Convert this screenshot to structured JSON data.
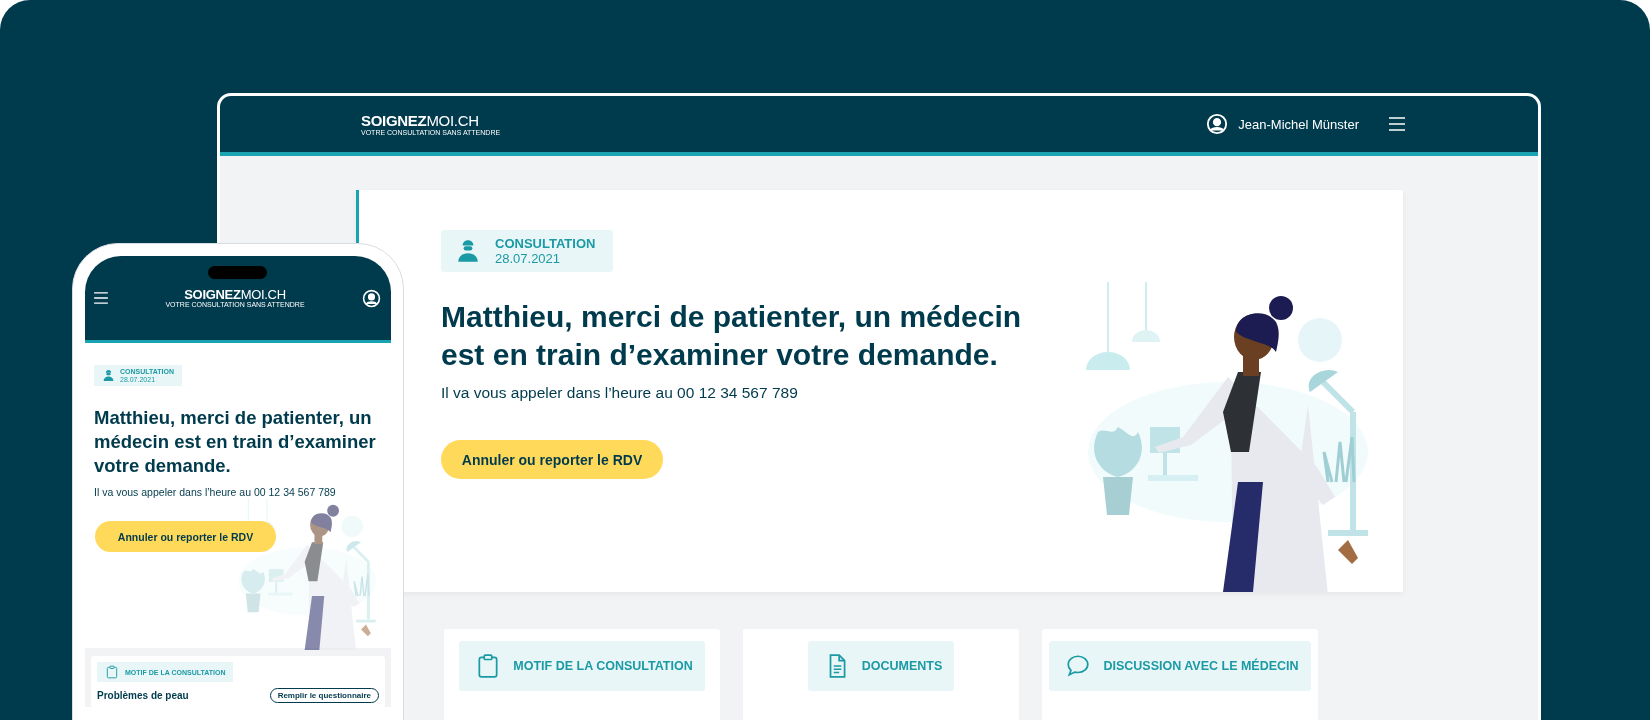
{
  "desktop": {
    "header": {
      "logo_bold": "SOIGNEZ",
      "logo_light": "MOI.CH",
      "tagline": "VOTRE CONSULTATION SANS ATTENDRE",
      "user_name": "Jean-Michel Münster"
    },
    "hero": {
      "badge_title": "CONSULTATION",
      "badge_date": "28.07.2021",
      "headline": "Matthieu, merci de patienter, un médecin est en train d’examiner votre demande.",
      "subtext": "Il va vous appeler dans l’heure au 00 12 34 567 789",
      "button": "Annuler ou reporter le RDV"
    },
    "sections": [
      {
        "kind": "clipboard",
        "label": "MOTIF DE LA CONSULTATION"
      },
      {
        "kind": "document",
        "label": "DOCUMENTS"
      },
      {
        "kind": "chat",
        "label": "DISCUSSION AVEC LE MÉDECIN"
      }
    ]
  },
  "mobile": {
    "header": {
      "logo_bold": "SOIGNEZ",
      "logo_light": "MOI.CH",
      "tagline": "VOTRE CONSULTATION SANS ATTENDRE"
    },
    "hero": {
      "badge_title": "CONSULTATION",
      "badge_date": "28.07.2021",
      "headline": "Matthieu, merci de patienter, un médecin est en train d’examiner votre demande.",
      "subtext": "Il va vous appeler dans l’heure au 00 12 34 567 789",
      "button": "Annuler ou reporter le RDV"
    },
    "section": {
      "kind": "clipboard",
      "label": "MOTIF DE LA CONSULTATION"
    },
    "reason": "Problèmes de peau",
    "questionnaire_button": "Remplir le questionnaire"
  }
}
